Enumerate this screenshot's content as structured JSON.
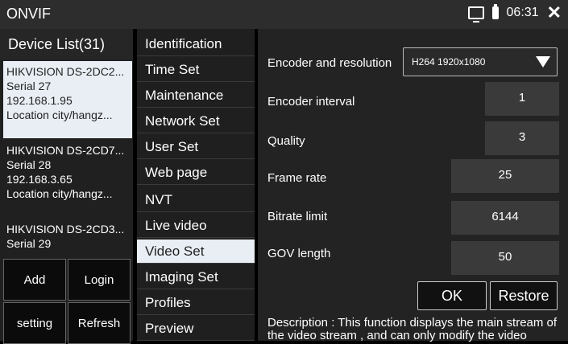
{
  "app_title": "ONVIF",
  "status": {
    "time": "06:31"
  },
  "device_list": {
    "header": "Device List(31)",
    "devices": [
      {
        "name": "HIKVISION DS-2DC2...",
        "serial": "Serial 27",
        "ip": "192.168.1.95",
        "location": "Location city/hangz..."
      },
      {
        "name": "HIKVISION DS-2CD7...",
        "serial": "Serial 28",
        "ip": "192.168.3.65",
        "location": "Location city/hangz..."
      },
      {
        "name": "HIKVISION DS-2CD3...",
        "serial": "Serial 29"
      }
    ],
    "buttons": [
      "Add",
      "Login",
      "setting",
      "Refresh"
    ]
  },
  "menu": {
    "items": [
      "Identification",
      "Time Set",
      "Maintenance",
      "Network Set",
      "User Set",
      "Web page",
      "NVT",
      "Live video",
      "Video Set",
      "Imaging Set",
      "Profiles",
      "Preview"
    ],
    "active": "Video Set"
  },
  "video_set": {
    "encoder_resolution_label": "Encoder and resolution",
    "encoder_resolution_value": "H264 1920x1080",
    "encoder_interval_label": "Encoder interval",
    "encoder_interval_value": "1",
    "quality_label": "Quality",
    "quality_value": "3",
    "frame_rate_label": "Frame rate",
    "frame_rate_value": "25",
    "bitrate_limit_label": "Bitrate limit",
    "bitrate_limit_value": "6144",
    "gov_length_label": "GOV length",
    "gov_length_value": "50",
    "ok_label": "OK",
    "restore_label": "Restore",
    "description": "Description : This function displays the main stream of the video stream , and can only modify the video"
  }
}
